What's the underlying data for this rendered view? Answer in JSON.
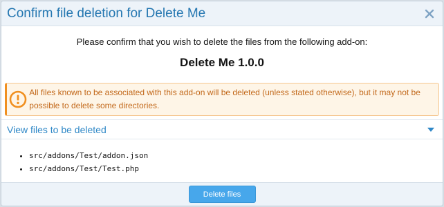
{
  "dialog": {
    "title": "Confirm file deletion for Delete Me",
    "close_icon": "close-icon"
  },
  "intro": "Please confirm that you wish to delete the files from the following add-on:",
  "addon_name": "Delete Me 1.0.0",
  "warning": {
    "icon": "warning-icon",
    "text": "All files known to be associated with this add-on will be deleted (unless stated otherwise), but it may not be possible to delete some directories.",
    "color": "#f08f1f"
  },
  "files_toggle": {
    "label": "View files to be deleted",
    "icon": "chevron-down-icon"
  },
  "files": [
    "src/addons/Test/addon.json",
    "src/addons/Test/Test.php"
  ],
  "footer": {
    "delete_label": "Delete files",
    "accent": "#47a7eb"
  }
}
